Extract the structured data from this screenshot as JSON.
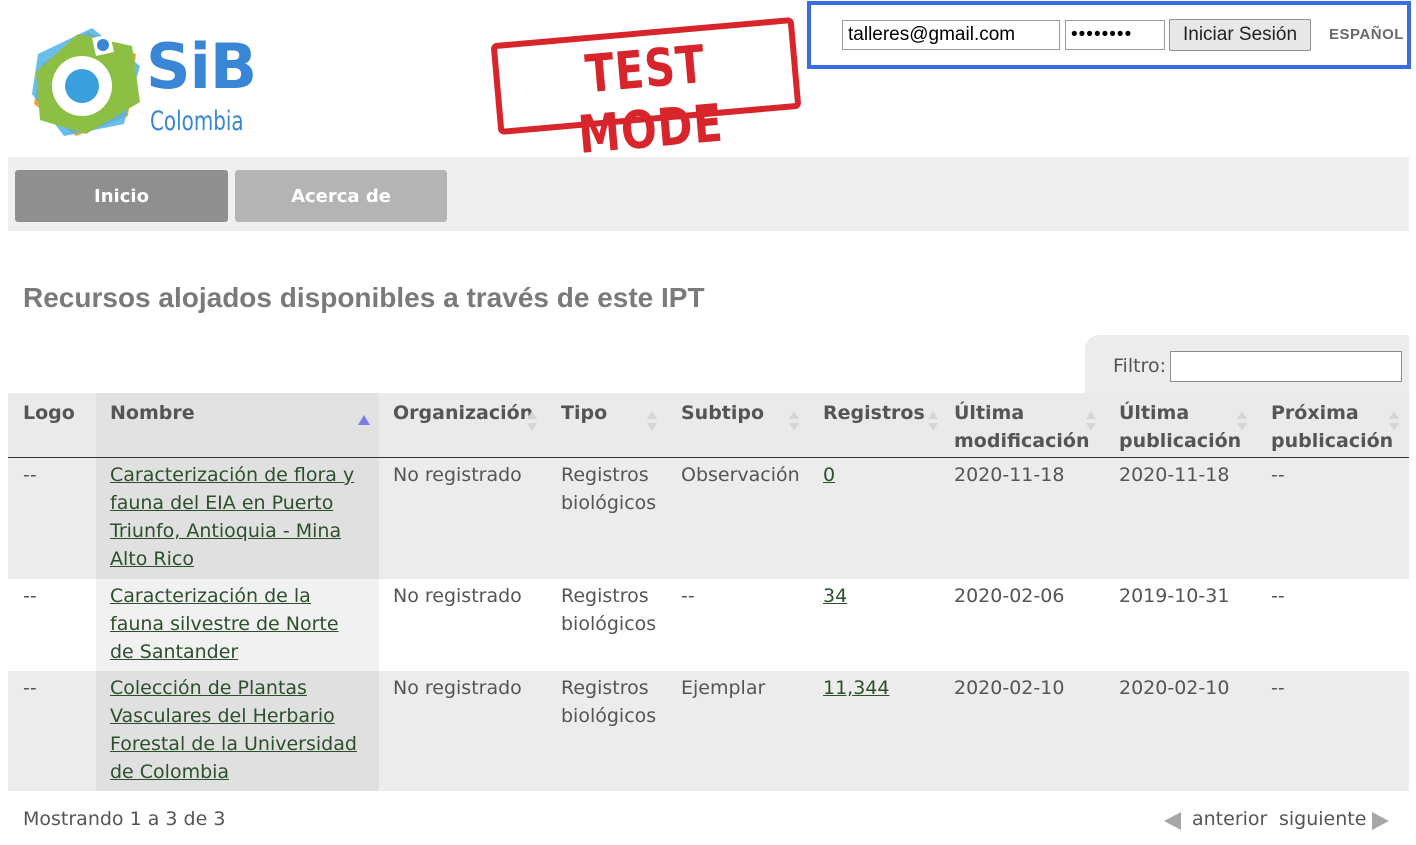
{
  "header": {
    "logo": {
      "brand": "SiB",
      "subtitle": "Colombia"
    },
    "test_stamp": "TEST MODE",
    "login": {
      "email_value": "talleres@gmail.com",
      "password_value": "••••••••",
      "button_label": "Iniciar Sesión",
      "language_label": "ESPAÑOL"
    }
  },
  "nav": {
    "items": [
      {
        "label": "Inicio"
      },
      {
        "label": "Acerca de"
      }
    ]
  },
  "main": {
    "title": "Recursos alojados disponibles a través de este IPT",
    "filter": {
      "label": "Filtro:",
      "value": ""
    },
    "table": {
      "columns": [
        {
          "label": "Logo"
        },
        {
          "label": "Nombre"
        },
        {
          "label": "Organización"
        },
        {
          "label": "Tipo"
        },
        {
          "label": "Subtipo"
        },
        {
          "label": "Registros"
        },
        {
          "label": "Última modificación"
        },
        {
          "label": "Última publicación"
        },
        {
          "label": "Próxima publicación"
        }
      ],
      "rows": [
        {
          "logo": "--",
          "name": "Caracterización de flora y fauna del EIA en Puerto Triunfo, Antioquia - Mina Alto Rico",
          "organization": "No registrado",
          "type": "Registros biológicos",
          "subtype": "Observación",
          "records": "0",
          "last_modified": "2020-11-18",
          "last_published": "2020-11-18",
          "next_publication": "--"
        },
        {
          "logo": "--",
          "name": "Caracterización de la fauna silvestre de Norte de Santander",
          "organization": "No registrado",
          "type": "Registros biológicos",
          "subtype": "--",
          "records": "34",
          "last_modified": "2020-02-06",
          "last_published": "2019-10-31",
          "next_publication": "--"
        },
        {
          "logo": "--",
          "name": "Colección de Plantas Vasculares del Herbario Forestal de la Universidad de Colombia",
          "organization": "No registrado",
          "type": "Registros biológicos",
          "subtype": "Ejemplar",
          "records": "11,344",
          "last_modified": "2020-02-10",
          "last_published": "2020-02-10",
          "next_publication": "--"
        }
      ]
    },
    "footer": {
      "showing": "Mostrando 1 a 3 de 3",
      "prev_label": "anterior",
      "next_label": "siguiente"
    }
  },
  "colors": {
    "login_border": "#3a6ee0",
    "stamp_red": "#d8252b",
    "logo_blue": "#3a86d6",
    "logo_green": "#8dbf45",
    "link_green": "#2d4f2d"
  }
}
